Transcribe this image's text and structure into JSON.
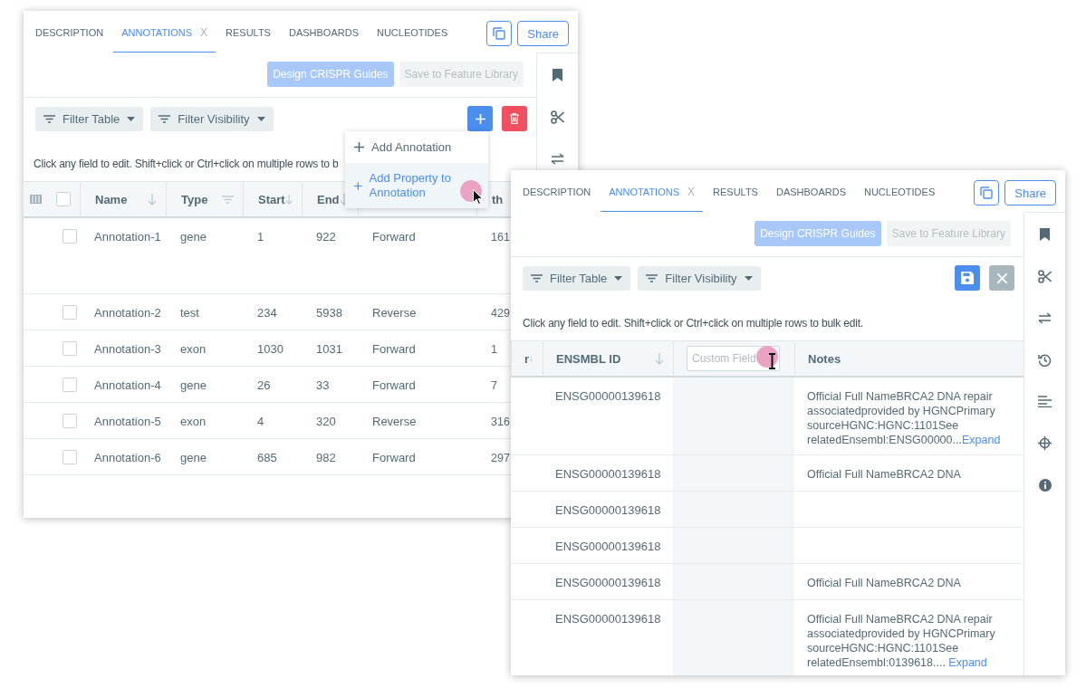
{
  "windows": [
    {
      "tabs": [
        {
          "label": "DESCRIPTION",
          "selected": false
        },
        {
          "label": "ANNOTATIONS",
          "selected": true,
          "close_mark": "X"
        },
        {
          "label": "RESULTS",
          "selected": false
        },
        {
          "label": "DASHBOARDS",
          "selected": false
        },
        {
          "label": "NUCLEOTIDES",
          "selected": false
        }
      ],
      "share_button": "Share",
      "toolbar_buttons": [
        {
          "label": "Design CRISPR Guides",
          "kind": "primary",
          "disabled": true
        },
        {
          "label": "Save to Feature Library",
          "kind": "secondary",
          "disabled": true
        }
      ],
      "filters": [
        "Filter Table",
        "Filter Visibility"
      ],
      "actions": [
        {
          "kind": "add"
        },
        {
          "kind": "delete"
        }
      ],
      "instruction": "Click any field to edit. Shift+click or Ctrl+click on multiple rows to b",
      "table": {
        "select_all": {
          "checked": false
        },
        "columns": [
          {
            "label": "Name",
            "kind": "sort"
          },
          {
            "label": "Type",
            "kind": "filter"
          },
          {
            "label": "Start",
            "kind": "sort"
          },
          {
            "label": "End",
            "kind": "sort"
          },
          {
            "kind": "blank"
          },
          {
            "label": "th",
            "kind": "plain"
          }
        ],
        "rows": [
          {
            "checked": false,
            "cells": [
              "Annotation-1",
              "gene",
              "1",
              "922",
              "Forward",
              "161"
            ]
          },
          {
            "checked": false,
            "cells": [
              "Annotation-2",
              "test",
              "234",
              "5938",
              "Reverse",
              "429"
            ]
          },
          {
            "checked": false,
            "cells": [
              "Annotation-3",
              "exon",
              "1030",
              "1031",
              "Forward",
              "1"
            ]
          },
          {
            "checked": false,
            "cells": [
              "Annotation-4",
              "gene",
              "26",
              "33",
              "Forward",
              "7"
            ]
          },
          {
            "checked": false,
            "cells": [
              "Annotation-5",
              "exon",
              "4",
              "320",
              "Reverse",
              "316"
            ]
          },
          {
            "checked": false,
            "cells": [
              "Annotation-6",
              "gene",
              "685",
              "982",
              "Forward",
              "297"
            ]
          }
        ]
      },
      "menu": {
        "items": [
          {
            "label": "Add Annotation",
            "selected": false
          },
          {
            "label": "Add Property to Annotation",
            "selected": true
          }
        ]
      },
      "cursor": {
        "kind": "pointer"
      }
    },
    {
      "tabs": [
        {
          "label": "DESCRIPTION",
          "selected": false
        },
        {
          "label": "ANNOTATIONS",
          "selected": true,
          "close_mark": "X"
        },
        {
          "label": "RESULTS",
          "selected": false
        },
        {
          "label": "DASHBOARDS",
          "selected": false
        },
        {
          "label": "NUCLEOTIDES",
          "selected": false
        }
      ],
      "share_button": "Share",
      "toolbar_buttons": [
        {
          "label": "Design CRISPR Guides",
          "kind": "primary",
          "disabled": true
        },
        {
          "label": "Save to Feature Library",
          "kind": "secondary",
          "disabled": true
        }
      ],
      "filters": [
        "Filter Table",
        "Filter Visibility"
      ],
      "actions": [
        {
          "kind": "save"
        },
        {
          "kind": "cancel"
        }
      ],
      "instruction": "Click any field to edit. Shift+click or Ctrl+click on multiple rows to bulk edit.",
      "table": {
        "columns": [
          {
            "label": "r",
            "kind": "sort"
          },
          {
            "label": "ENSMBL ID",
            "kind": "sort"
          },
          {
            "placeholder": "Custom Field",
            "kind": "field"
          },
          {
            "label": "Notes",
            "kind": "plain"
          }
        ],
        "rows": [
          {
            "cells": [
              null,
              "ENSG00000139618",
              null,
              {
                "text": "Official Full NameBRCA2 DNA repair associatedprovided by HGNCPrimary sourceHGNC:HGNC:1101See relatedEnsembl:ENSG00000...",
                "link": "Expand"
              }
            ]
          },
          {
            "cells": [
              null,
              "ENSG00000139618",
              null,
              "Official Full NameBRCA2 DNA"
            ]
          },
          {
            "cells": [
              null,
              "ENSG00000139618",
              null,
              null
            ]
          },
          {
            "cells": [
              null,
              "ENSG00000139618",
              null,
              null
            ]
          },
          {
            "cells": [
              null,
              "ENSG00000139618",
              null,
              "Official Full NameBRCA2 DNA"
            ]
          },
          {
            "cells": [
              null,
              "ENSG00000139618",
              null,
              {
                "text": "Official Full NameBRCA2 DNA repair associatedprovided by HGNCPrimary sourceHGNC:HGNC:1101See relatedEnsembl:0139618.... ",
                "link": "Expand"
              }
            ]
          }
        ]
      },
      "cursor": {
        "kind": "text"
      }
    }
  ]
}
